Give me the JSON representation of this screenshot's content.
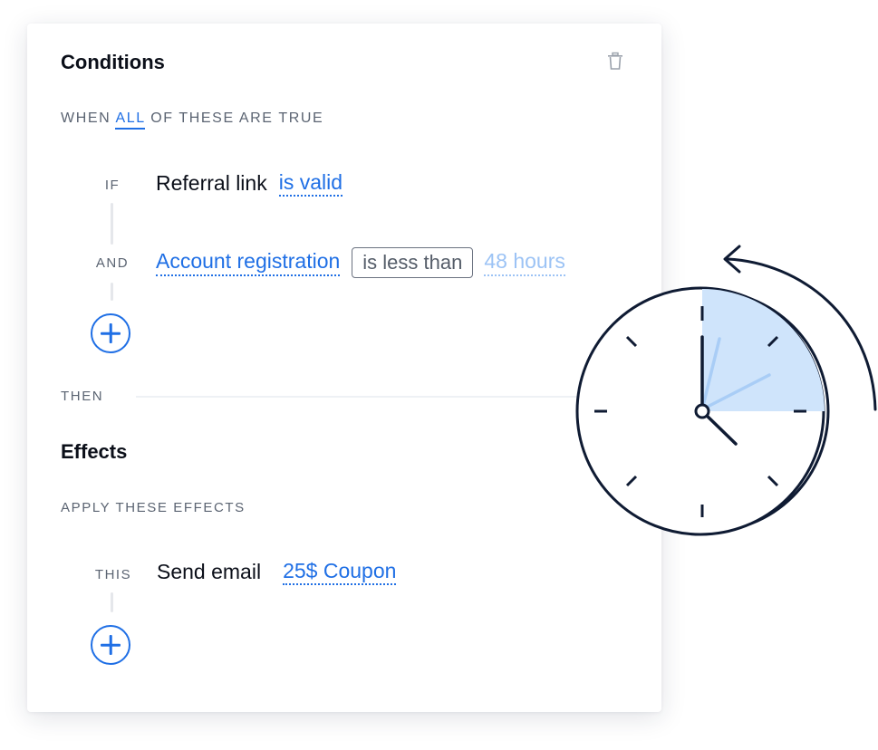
{
  "conditions": {
    "title": "Conditions",
    "when_prefix": "WHEN",
    "when_mode": "ALL",
    "when_suffix": "OF THESE ARE TRUE",
    "rows": [
      {
        "label": "IF",
        "subject": "Referral link",
        "operator": "is valid"
      },
      {
        "label": "AND",
        "subject": "Account registration",
        "operator": "is less than",
        "value": "48 hours"
      }
    ]
  },
  "then_label": "THEN",
  "effects": {
    "title": "Effects",
    "subtitle": "APPLY THESE EFFECTS",
    "rows": [
      {
        "label": "THIS",
        "action": "Send email",
        "target": "25$ Coupon"
      }
    ]
  },
  "icons": {
    "delete": "trash-icon",
    "add": "plus-circle-icon",
    "illustration": "clock-rewind-icon"
  },
  "colors": {
    "accent": "#1f6fe5",
    "accent_faded": "#9cc3f5",
    "clock_fill": "#cfe4fb",
    "clock_stroke": "#0f1b33"
  }
}
